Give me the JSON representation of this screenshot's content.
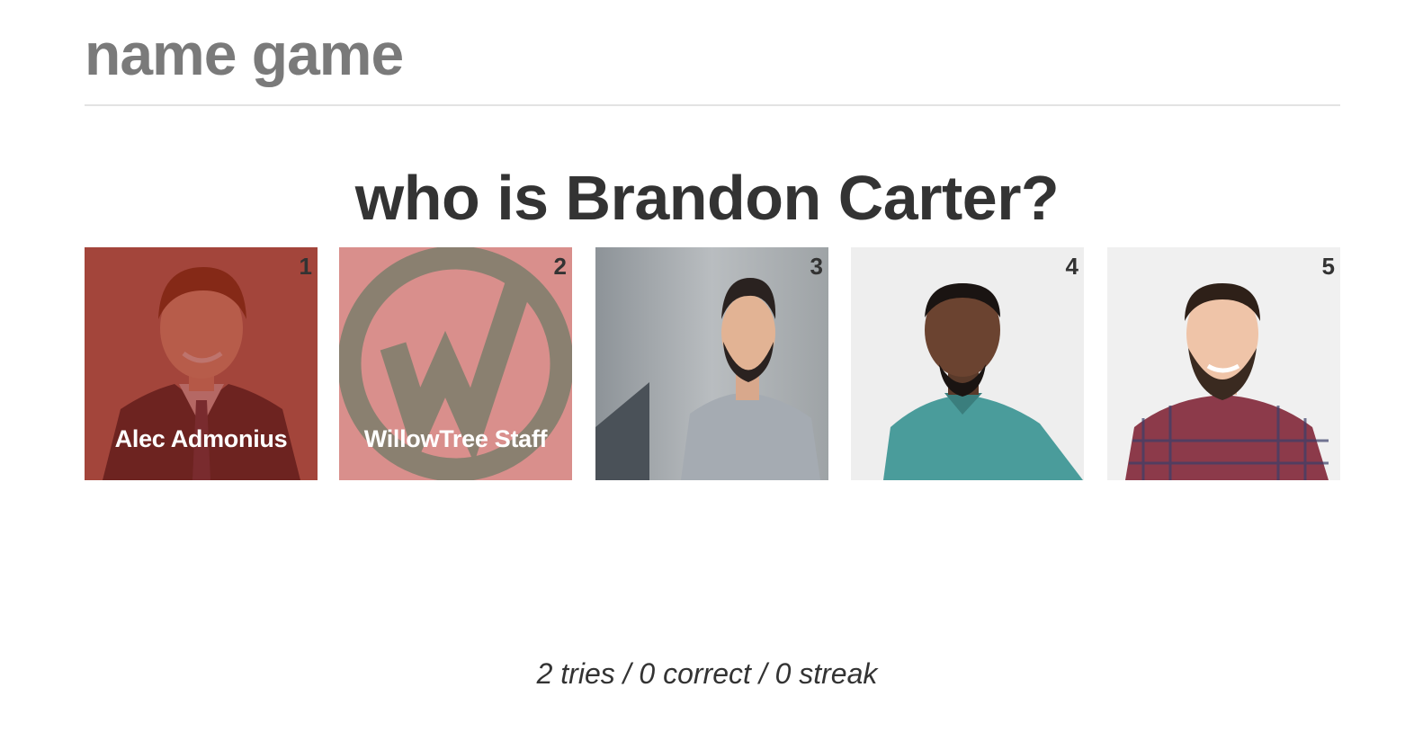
{
  "app": {
    "title": "name game"
  },
  "question": {
    "text": "who is Brandon Carter?"
  },
  "tiles": [
    {
      "number": "1",
      "name": "Alec Admonius",
      "state": "wrong",
      "overlay_color": "#a02a22"
    },
    {
      "number": "2",
      "name": "WillowTree Staff",
      "state": "wrong",
      "overlay_color": "#d8888a"
    },
    {
      "number": "3",
      "name": "",
      "state": "unanswered"
    },
    {
      "number": "4",
      "name": "",
      "state": "unanswered"
    },
    {
      "number": "5",
      "name": "",
      "state": "unanswered"
    }
  ],
  "stats": {
    "text": "2 tries / 0 correct / 0 streak"
  },
  "colors": {
    "title": "#7a7a7a",
    "text": "#333333",
    "wrong_overlay": "#a02a22",
    "logo_gray": "#8a8070"
  }
}
